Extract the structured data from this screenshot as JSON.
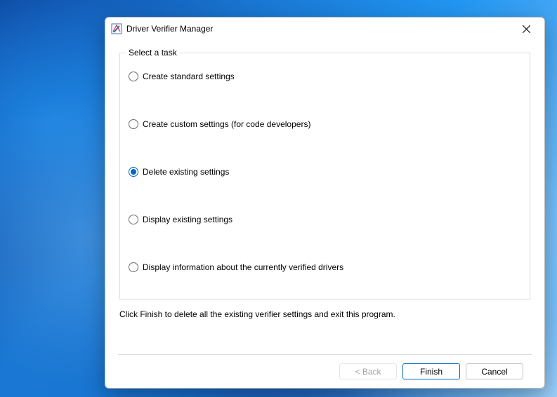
{
  "window": {
    "title": "Driver Verifier Manager"
  },
  "group": {
    "label": "Select a task"
  },
  "options": {
    "o0": "Create standard settings",
    "o1": "Create custom settings (for code developers)",
    "o2": "Delete existing settings",
    "o3": "Display existing settings",
    "o4": "Display information about the currently verified drivers",
    "selected_index": 2
  },
  "hint": "Click Finish to delete all the existing verifier settings and exit this program.",
  "buttons": {
    "back": "< Back",
    "finish": "Finish",
    "cancel": "Cancel"
  }
}
